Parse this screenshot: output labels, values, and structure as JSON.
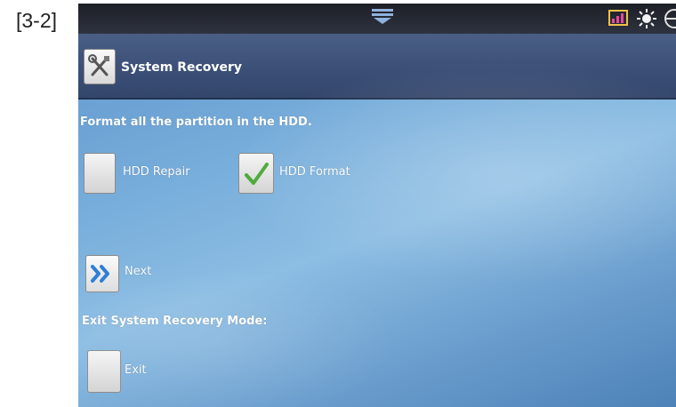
{
  "figure_label": "[3-2]",
  "header": {
    "title": "System Recovery",
    "icon": "tools-icon"
  },
  "instruction": "Format all the partition in the HDD.",
  "options": [
    {
      "label": "HDD Repair",
      "checked": false
    },
    {
      "label": "HDD Format",
      "checked": true
    }
  ],
  "next_label": "Next",
  "exit_section": {
    "heading": "Exit System Recovery Mode:",
    "label": "Exit",
    "checked": false
  },
  "status_icons": [
    "signal-bars-icon",
    "brightness-icon",
    "globe-icon"
  ],
  "colors": {
    "title_bar": "#3a4e76",
    "status_bar": "#1d1f26",
    "check": "#4caa3a",
    "next_arrow": "#2f7fd8"
  }
}
